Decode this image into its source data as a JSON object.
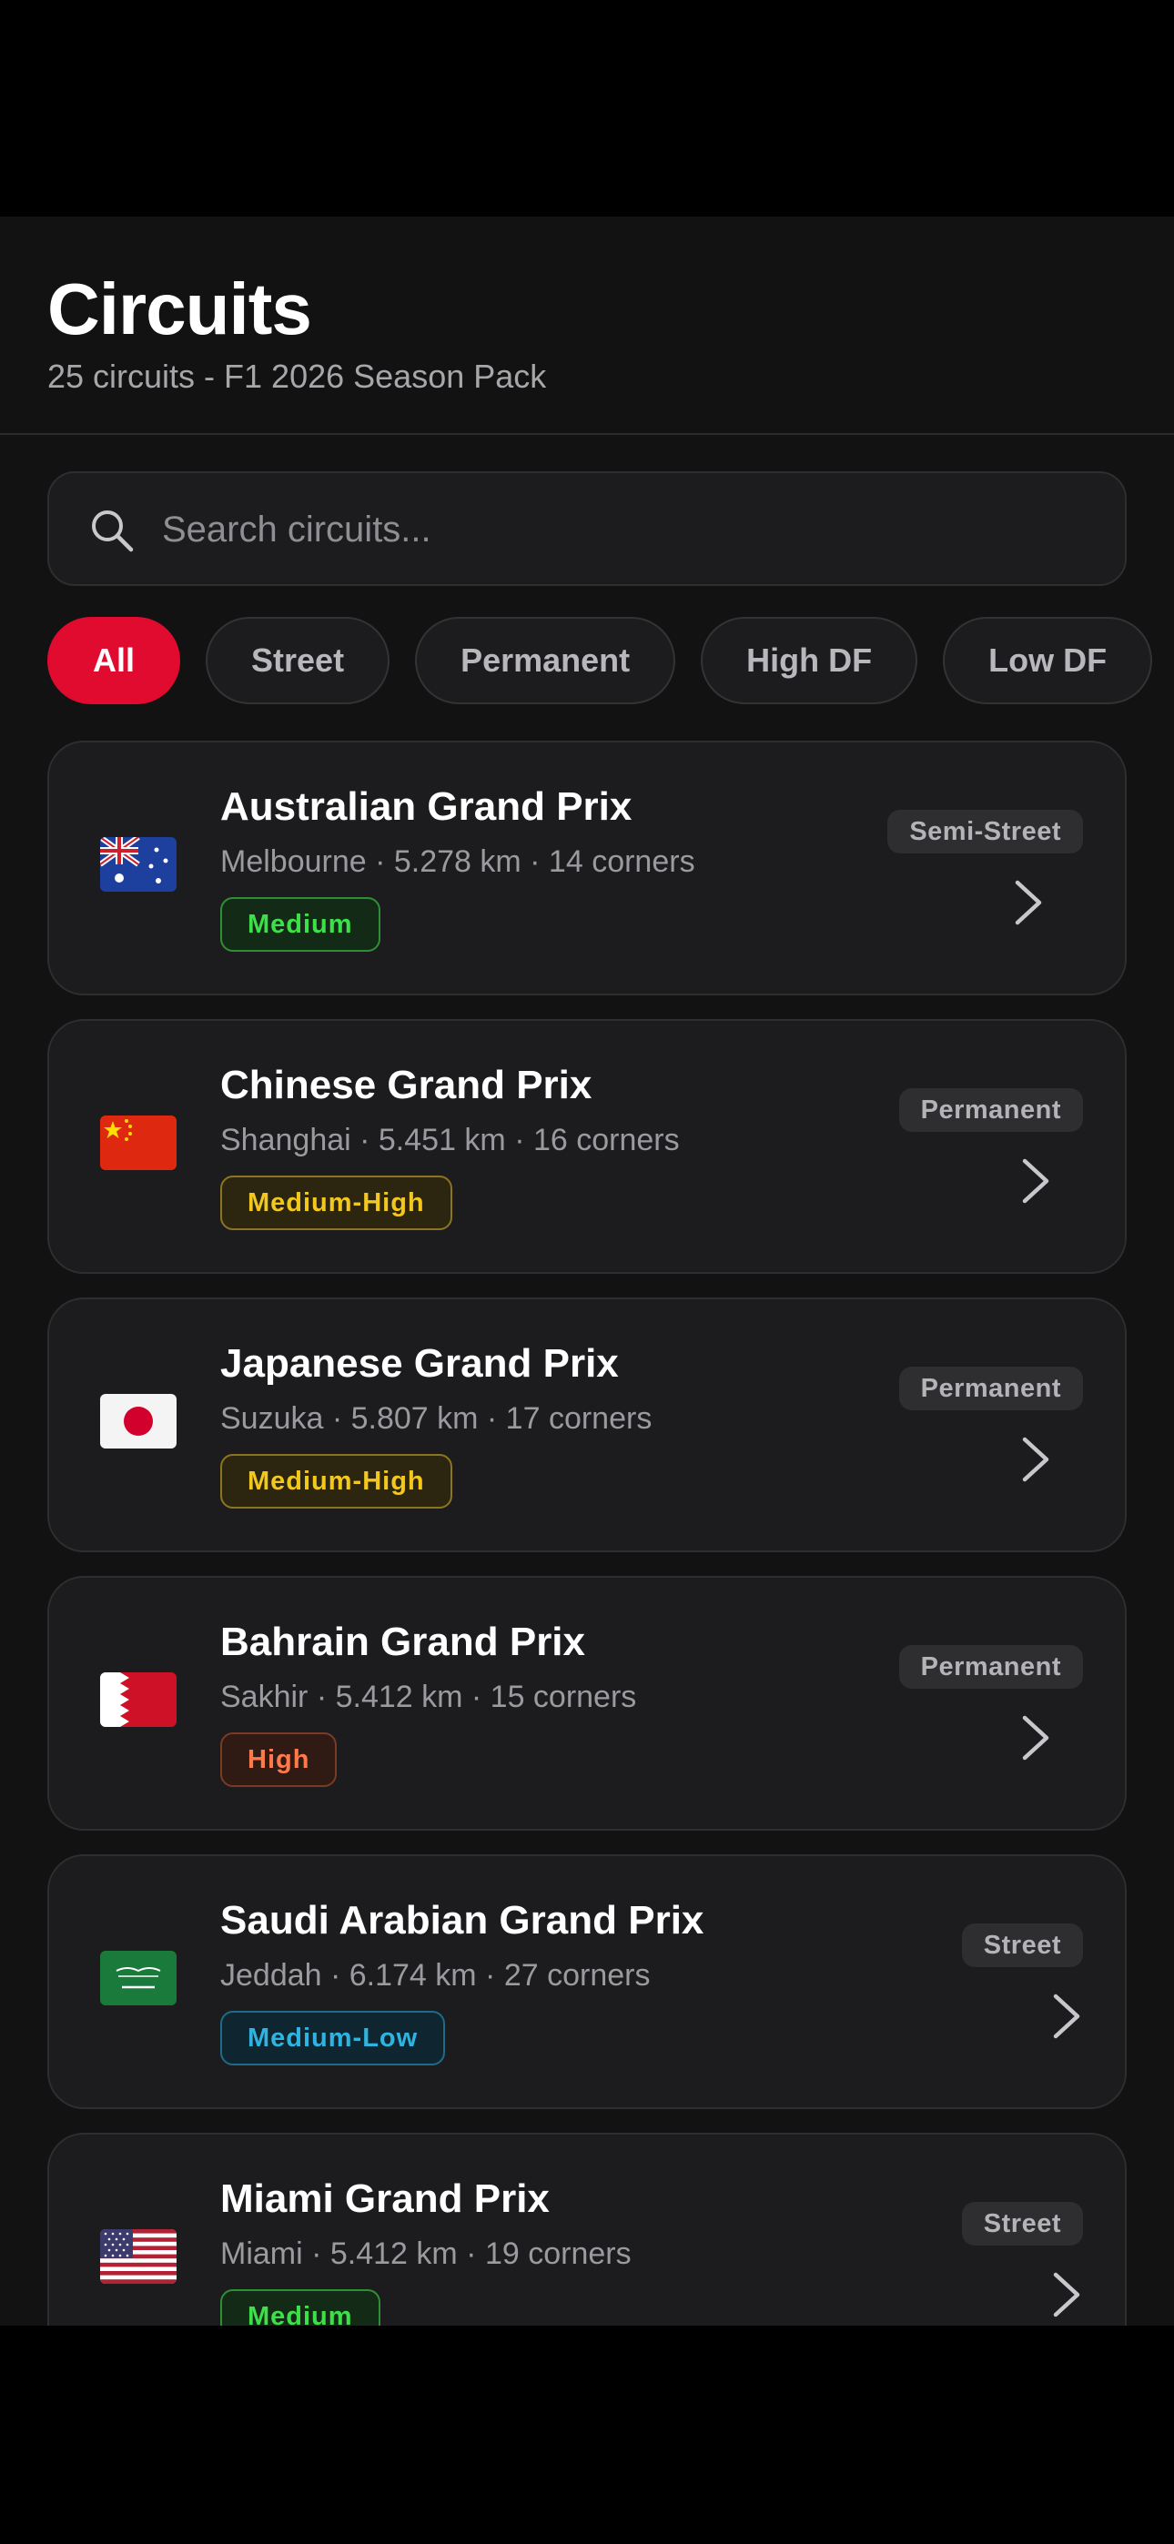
{
  "header": {
    "title": "Circuits",
    "subtitle": "25 circuits - F1 2026 Season Pack"
  },
  "search": {
    "placeholder": "Search circuits...",
    "icon": "search-icon"
  },
  "filters": [
    {
      "label": "All",
      "active": true
    },
    {
      "label": "Street",
      "active": false
    },
    {
      "label": "Permanent",
      "active": false
    },
    {
      "label": "High DF",
      "active": false
    },
    {
      "label": "Low DF",
      "active": false
    }
  ],
  "colors": {
    "accent": "#e10a2f",
    "background": "#121212",
    "card": "#1c1c1e",
    "medium": "#3ee04a",
    "medium_high": "#f2c81e",
    "high": "#ff7a4a",
    "medium_low": "#2fb3e0"
  },
  "circuits": [
    {
      "name": "Australian Grand Prix",
      "meta": "Melbourne · 5.278 km · 14 corners",
      "downforce": "Medium",
      "type": "Semi-Street",
      "flag": "australia-flag"
    },
    {
      "name": "Chinese Grand Prix",
      "meta": "Shanghai · 5.451 km · 16 corners",
      "downforce": "Medium-High",
      "type": "Permanent",
      "flag": "china-flag"
    },
    {
      "name": "Japanese Grand Prix",
      "meta": "Suzuka · 5.807 km · 17 corners",
      "downforce": "Medium-High",
      "type": "Permanent",
      "flag": "japan-flag"
    },
    {
      "name": "Bahrain Grand Prix",
      "meta": "Sakhir · 5.412 km · 15 corners",
      "downforce": "High",
      "type": "Permanent",
      "flag": "bahrain-flag"
    },
    {
      "name": "Saudi Arabian Grand Prix",
      "meta": "Jeddah · 6.174 km · 27 corners",
      "downforce": "Medium-Low",
      "type": "Street",
      "flag": "saudi-arabia-flag"
    },
    {
      "name": "Miami Grand Prix",
      "meta": "Miami · 5.412 km · 19 corners",
      "downforce": "Medium",
      "type": "Street",
      "flag": "usa-flag"
    }
  ]
}
